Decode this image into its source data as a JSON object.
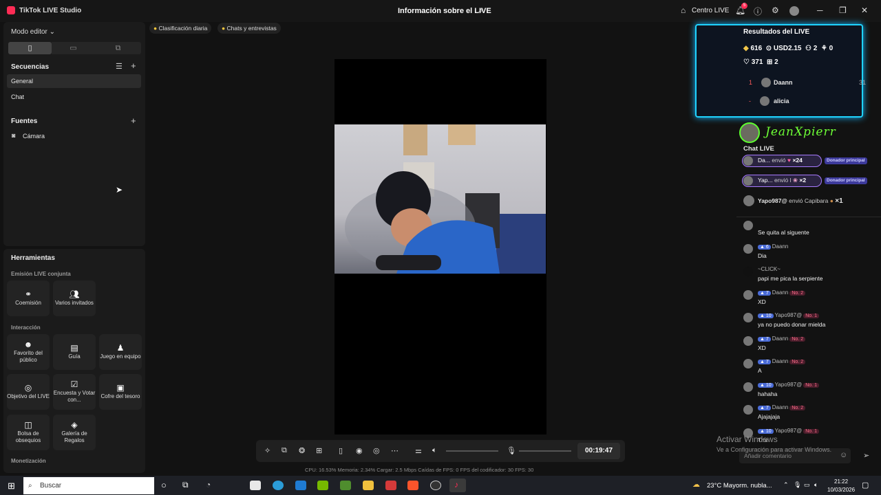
{
  "window": {
    "app_title": "TikTok LIVE Studio",
    "title": "Información sobre el LIVE",
    "centro_live": "Centro LIVE",
    "notif_count": "5"
  },
  "left": {
    "mode": "Modo editor",
    "sequences_title": "Secuencias",
    "sequences": [
      "General",
      "Chat"
    ],
    "sources_title": "Fuentes",
    "sources": [
      "Cámara"
    ],
    "tools_title": "Herramientas",
    "group_joint": "Emisión LIVE conjunta",
    "group_interaction": "Interacción",
    "group_monetization": "Monetización",
    "tools_joint": [
      "Coemisión",
      "Varios invitados"
    ],
    "tools_interaction": [
      "Favorito del público",
      "Guía",
      "Juego en equipo",
      "Objetivo del LIVE",
      "Encuesta y Votar con...",
      "Cofre del tesoro",
      "Bolsa de obsequios",
      "Galería de Regalos"
    ]
  },
  "top_pills": [
    "Clasificación diaria",
    "Chats y entrevistas"
  ],
  "controls": {
    "timer": "00:19:47"
  },
  "stats": "CPU:  16.53%      Memoria:  2.34%      Cargar:  2.5 Mbps      Caídas de FPS:  0      FPS del codificador:  30      FPS:  30",
  "results": {
    "title": "Resultados del LIVE",
    "diamonds": "616",
    "usd": "USD2.15",
    "users": "2",
    "shares": "0",
    "likes": "371",
    "gifts": "2",
    "ranking": [
      {
        "rank": "1",
        "name": "Daann",
        "score": "31"
      },
      {
        "rank": "-",
        "name": "alicia",
        "score": ""
      }
    ]
  },
  "streamer": "JeanXpierr",
  "chat": {
    "title": "Chat LIVE",
    "gifts": [
      {
        "user": "Da...",
        "action": "envió",
        "count": "×24",
        "badge": "Donador principal"
      },
      {
        "user": "Yap...",
        "action": "envió l",
        "count": "×2",
        "badge": "Donador principal"
      },
      {
        "user": "Yapo987@",
        "action": "envió Capibara",
        "count": "×1"
      }
    ],
    "messages": [
      {
        "level": "",
        "user": "",
        "rank": "",
        "text": "Se quita al siguente"
      },
      {
        "level": "6",
        "user": "Daann",
        "rank": "",
        "text": "Dia"
      },
      {
        "level": "",
        "user": "~CLICK~",
        "rank": "",
        "text": "papi me pica la serpiente"
      },
      {
        "level": "7",
        "user": "Daann",
        "rank": "No. 2",
        "text": "XD"
      },
      {
        "level": "10",
        "user": "Yapo987@",
        "rank": "No. 1",
        "text": "ya no puedo donar mielda"
      },
      {
        "level": "7",
        "user": "Daann",
        "rank": "No. 2",
        "text": "XD"
      },
      {
        "level": "7",
        "user": "Daann",
        "rank": "No. 2",
        "text": "A"
      },
      {
        "level": "10",
        "user": "Yapo987@",
        "rank": "No. 1",
        "text": "hahaha"
      },
      {
        "level": "7",
        "user": "Daann",
        "rank": "No. 2",
        "text": "Ajajajaja"
      },
      {
        "level": "10",
        "user": "Yapo987@",
        "rank": "No. 1",
        "text": "Tmr"
      }
    ],
    "input_placeholder": "Añadir comentario"
  },
  "watermark": {
    "line1": "Activar Windows",
    "line2": "Ve a Configuración para activar Windows."
  },
  "taskbar": {
    "search": "Buscar",
    "weather": "23°C  Mayorm. nubla...",
    "time": "21:22",
    "date": "10/03/2026"
  }
}
